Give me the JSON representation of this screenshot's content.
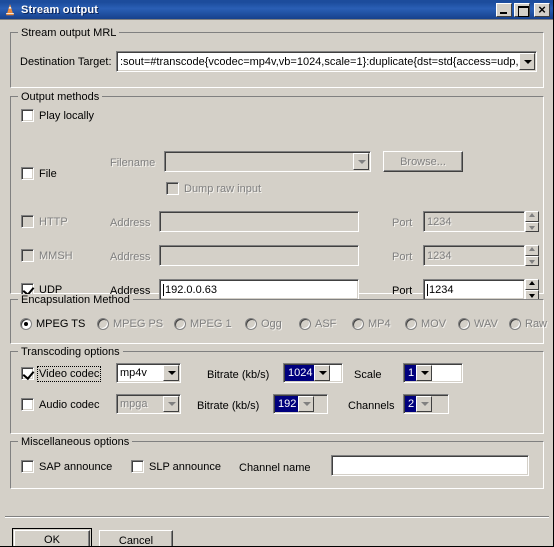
{
  "window": {
    "title": "Stream output",
    "icon": "vlc-cone-icon",
    "controls": {
      "minimize": "minimize-icon",
      "maximize": "maximize-icon",
      "close": "close-icon"
    }
  },
  "mrl_group": {
    "legend": "Stream output MRL",
    "destination_label": "Destination Target:",
    "destination_value": ":sout=#transcode{vcodec=mp4v,vb=1024,scale=1}:duplicate{dst=std{access=udp,",
    "destination_placeholder": ""
  },
  "output_methods": {
    "legend": "Output methods",
    "play_locally": {
      "label": "Play locally",
      "checked": false
    },
    "file": {
      "label": "File",
      "checked": false,
      "filename_label": "Filename",
      "filename_value": "",
      "browse_label": "Browse...",
      "dump_raw_label": "Dump raw input",
      "dump_raw_checked": false
    },
    "http": {
      "label": "HTTP",
      "checked": false,
      "address_label": "Address",
      "address_value": "",
      "port_label": "Port",
      "port_value": "1234"
    },
    "mmsh": {
      "label": "MMSH",
      "checked": false,
      "address_label": "Address",
      "address_value": "",
      "port_label": "Port",
      "port_value": "1234"
    },
    "udp": {
      "label": "UDP",
      "checked": true,
      "address_label": "Address",
      "address_value": "192.0.0.63",
      "port_label": "Port",
      "port_value": "1234"
    }
  },
  "encapsulation": {
    "legend": "Encapsulation Method",
    "selected": "MPEG TS",
    "options": [
      {
        "label": "MPEG TS",
        "selected": true,
        "enabled": true
      },
      {
        "label": "MPEG PS",
        "selected": false,
        "enabled": false
      },
      {
        "label": "MPEG 1",
        "selected": false,
        "enabled": false
      },
      {
        "label": "Ogg",
        "selected": false,
        "enabled": false
      },
      {
        "label": "ASF",
        "selected": false,
        "enabled": false
      },
      {
        "label": "MP4",
        "selected": false,
        "enabled": false
      },
      {
        "label": "MOV",
        "selected": false,
        "enabled": false
      },
      {
        "label": "WAV",
        "selected": false,
        "enabled": false
      },
      {
        "label": "Raw",
        "selected": false,
        "enabled": false
      }
    ]
  },
  "transcoding": {
    "legend": "Transcoding options",
    "video": {
      "label": "Video codec",
      "checked": true,
      "codec_value": "mp4v",
      "bitrate_label": "Bitrate (kb/s)",
      "bitrate_value": "1024",
      "scale_label": "Scale",
      "scale_value": "1"
    },
    "audio": {
      "label": "Audio codec",
      "checked": false,
      "codec_value": "mpga",
      "bitrate_label": "Bitrate (kb/s)",
      "bitrate_value": "192",
      "channels_label": "Channels",
      "channels_value": "2"
    }
  },
  "misc": {
    "legend": "Miscellaneous options",
    "sap": {
      "label": "SAP announce",
      "checked": false
    },
    "slp": {
      "label": "SLP announce",
      "checked": false
    },
    "channel_name_label": "Channel name",
    "channel_name_value": ""
  },
  "footer": {
    "ok_label": "OK",
    "cancel_label": "Cancel"
  },
  "colors": {
    "face": "#d4d0c8",
    "titlebar": "#1c4c9c",
    "selection": "#00007d",
    "disabled_text": "#808080",
    "field": "#ffffff"
  }
}
